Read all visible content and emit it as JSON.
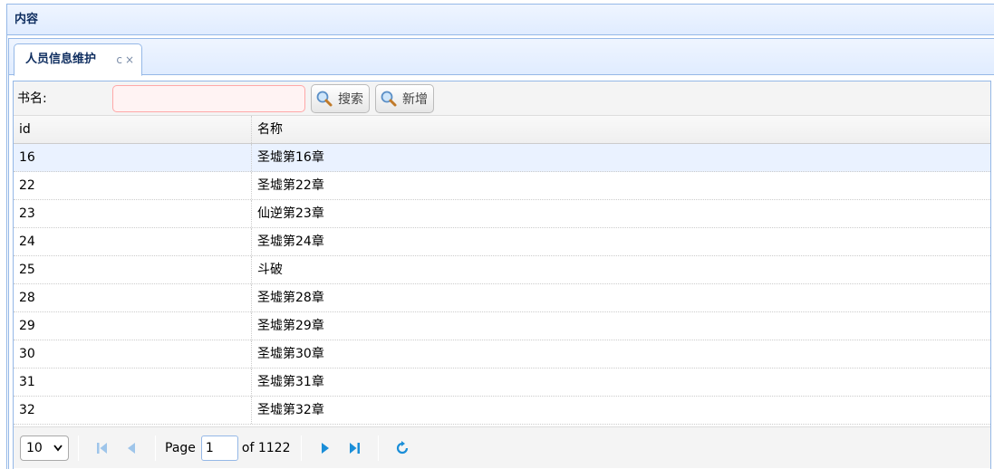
{
  "outer_panel": {
    "title": "内容"
  },
  "tab": {
    "label": "人员信息维护",
    "refresh_symbol": "c",
    "close_symbol": "×"
  },
  "toolbar": {
    "label": "书名:",
    "search_placeholder": "",
    "search_button": "搜索",
    "add_button": "新增"
  },
  "grid": {
    "columns": [
      "id",
      "名称"
    ],
    "rows": [
      {
        "id": "16",
        "name": "圣墟第16章"
      },
      {
        "id": "22",
        "name": "圣墟第22章"
      },
      {
        "id": "23",
        "name": "仙逆第23章"
      },
      {
        "id": "24",
        "name": "圣墟第24章"
      },
      {
        "id": "25",
        "name": "斗破"
      },
      {
        "id": "28",
        "name": "圣墟第28章"
      },
      {
        "id": "29",
        "name": "圣墟第29章"
      },
      {
        "id": "30",
        "name": "圣墟第30章"
      },
      {
        "id": "31",
        "name": "圣墟第31章"
      },
      {
        "id": "32",
        "name": "圣墟第32章"
      }
    ]
  },
  "pager": {
    "page_size": "10",
    "page_label": "Page",
    "current_page": "1",
    "of_label": "of 1122"
  },
  "colors": {
    "accent": "#95b8e7",
    "icon_blue": "#1a8ed8",
    "header_text": "#0e2d5f"
  }
}
